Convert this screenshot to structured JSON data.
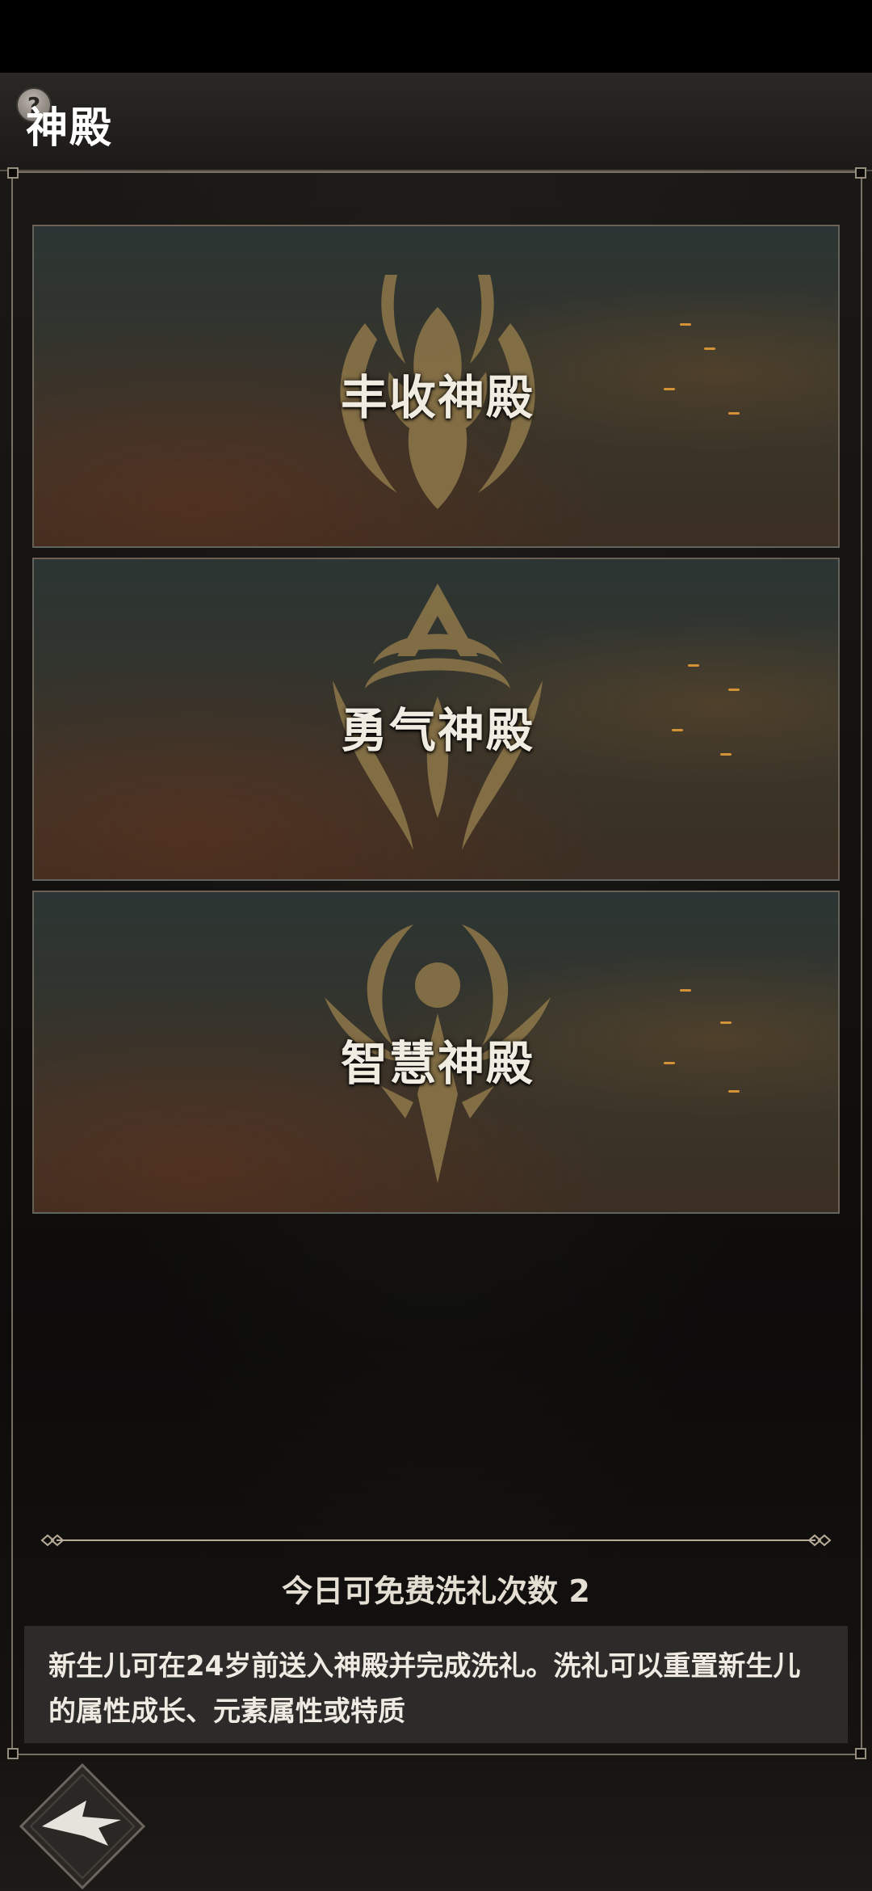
{
  "header": {
    "title": "神殿",
    "help_icon": "question-mark-icon"
  },
  "temples": [
    {
      "label": "丰收神殿",
      "emblem": "dragon-crest-icon"
    },
    {
      "label": "勇气神殿",
      "emblem": "triangle-horns-crest-icon"
    },
    {
      "label": "智慧神殿",
      "emblem": "winged-orb-crest-icon"
    }
  ],
  "footer": {
    "free_baptism_text": "今日可免费洗礼次数 2",
    "description": "新生儿可在24岁前送入神殿并完成洗礼。洗礼可以重置新生儿的属性成长、元素属性或特质"
  },
  "navigation": {
    "back_icon": "back-arrow-icon"
  },
  "colors": {
    "emblem_gold": "#8a7448",
    "frame_line": "#c8beaa",
    "text_main": "#efeae2"
  }
}
